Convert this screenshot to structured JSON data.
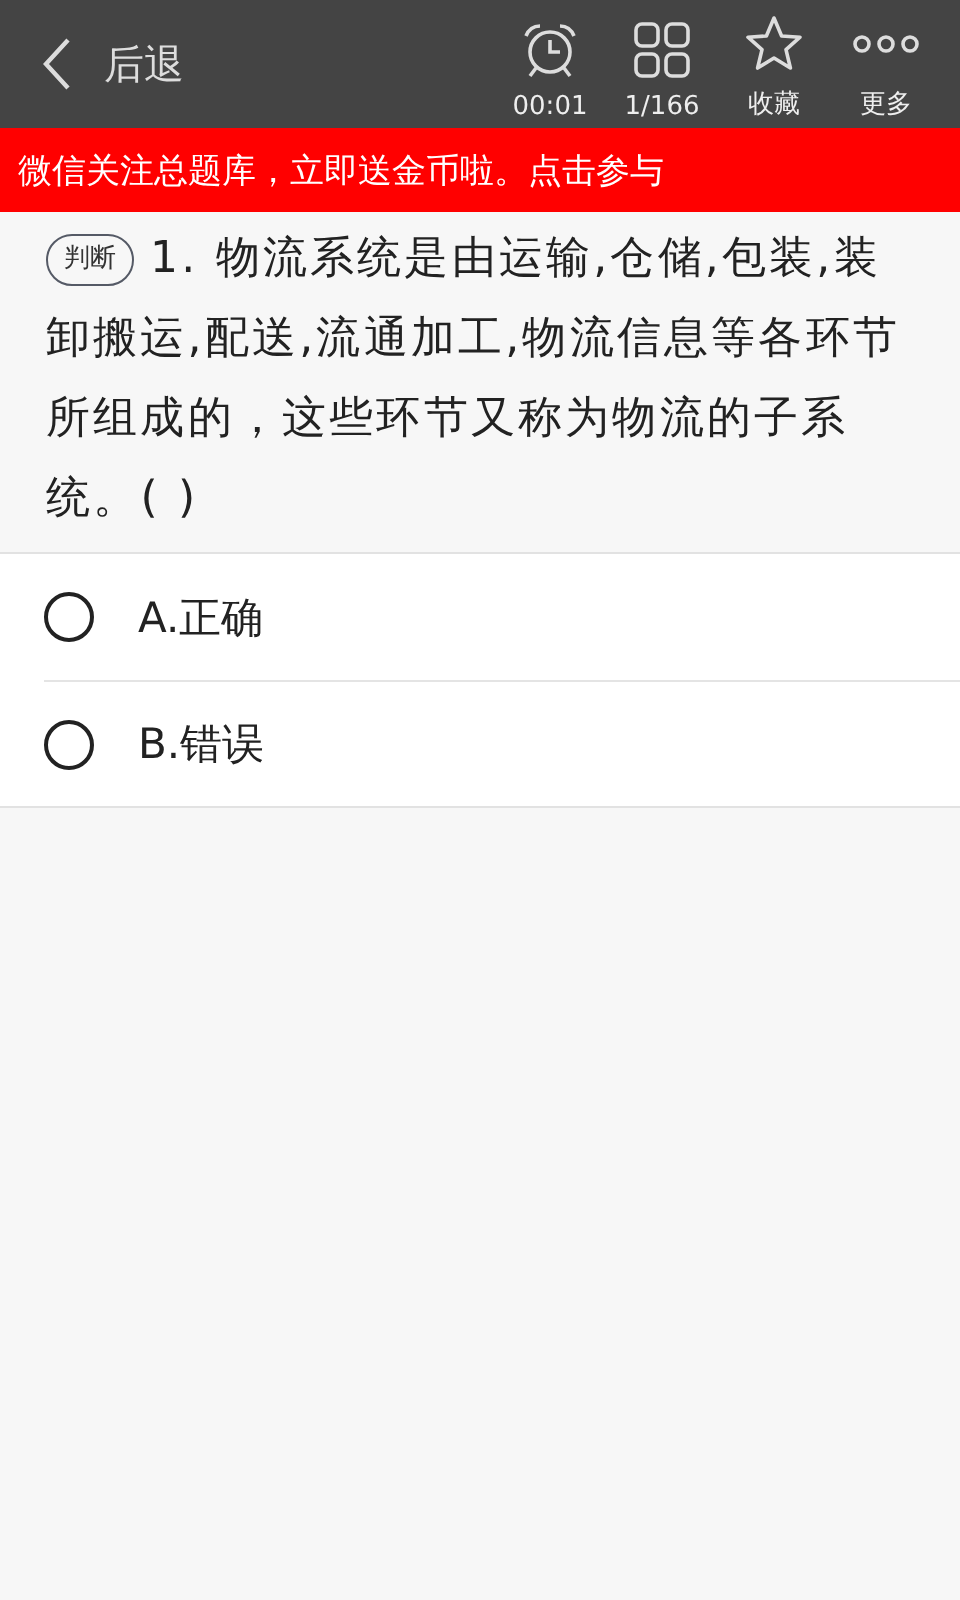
{
  "top_bar": {
    "back_label": "后退",
    "tools": [
      {
        "kind": "clock",
        "label": "00:01"
      },
      {
        "kind": "grid",
        "label": "1/166"
      },
      {
        "kind": "star",
        "label": "收藏"
      },
      {
        "kind": "dots",
        "label": "更多"
      }
    ]
  },
  "banner": "微信关注总题库，立即送金币啦。点击参与",
  "question": {
    "type_tag": "判断",
    "text": "1. 物流系统是由运输,仓储,包装,装卸搬运,配送,流通加工,物流信息等各环节所组成的，这些环节又称为物流的子系统。( )"
  },
  "options": [
    {
      "label": "A.正确",
      "selected": false
    },
    {
      "label": "B.错误",
      "selected": false
    }
  ]
}
